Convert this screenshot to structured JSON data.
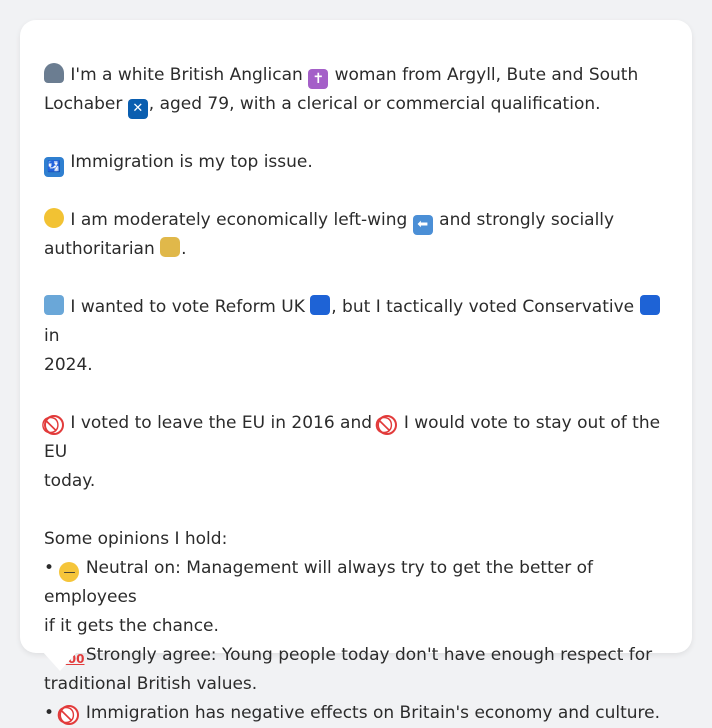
{
  "profile": {
    "intro_a": "I'm a white British Anglican",
    "intro_b": "woman from Argyll, Bute and South",
    "intro_c": "Lochaber",
    "intro_d": ", aged 79, with a clerical or commercial qualification.",
    "issue": "Immigration is my top issue.",
    "econ_a": "I am moderately economically left-wing",
    "econ_b": "and strongly socially",
    "econ_c": "authoritarian",
    "econ_d": ".",
    "vote_a": "I wanted to vote Reform UK",
    "vote_b": ", but I tactically voted Conservative",
    "vote_c": "in",
    "vote_d": "2024.",
    "eu_a": "I voted to leave the EU in 2016 and",
    "eu_b": "I would vote to stay out of the EU",
    "eu_c": "today.",
    "opinions_heading": "Some opinions I hold:",
    "opinions": [
      {
        "bullet": "•",
        "line1": "Neutral on: Management will always try to get the better of employees",
        "line2": "if it gets the chance."
      },
      {
        "bullet": "•",
        "line1": "Strongly agree: Young people today don't have enough respect for",
        "line2": "traditional British values."
      },
      {
        "bullet": "•",
        "line1": "Immigration has negative effects on Britain's economy and culture."
      }
    ]
  },
  "icons": {
    "person": "person-icon",
    "cross": "latin-cross-icon",
    "scotland_flag": "scotland-flag-icon",
    "immigration": "passport-control-icon",
    "thinking": "thinking-face-icon",
    "left_arrow": "left-arrow-icon",
    "lock": "lock-icon",
    "ballot": "ballot-box-icon",
    "blue_square": "blue-square-icon",
    "prohibited": "prohibited-icon",
    "neutral": "neutral-face-icon",
    "hundred": "hundred-points-icon"
  },
  "colors": {
    "background": "#f1f2f4",
    "card": "#ffffff",
    "text": "#2b2b2b"
  }
}
